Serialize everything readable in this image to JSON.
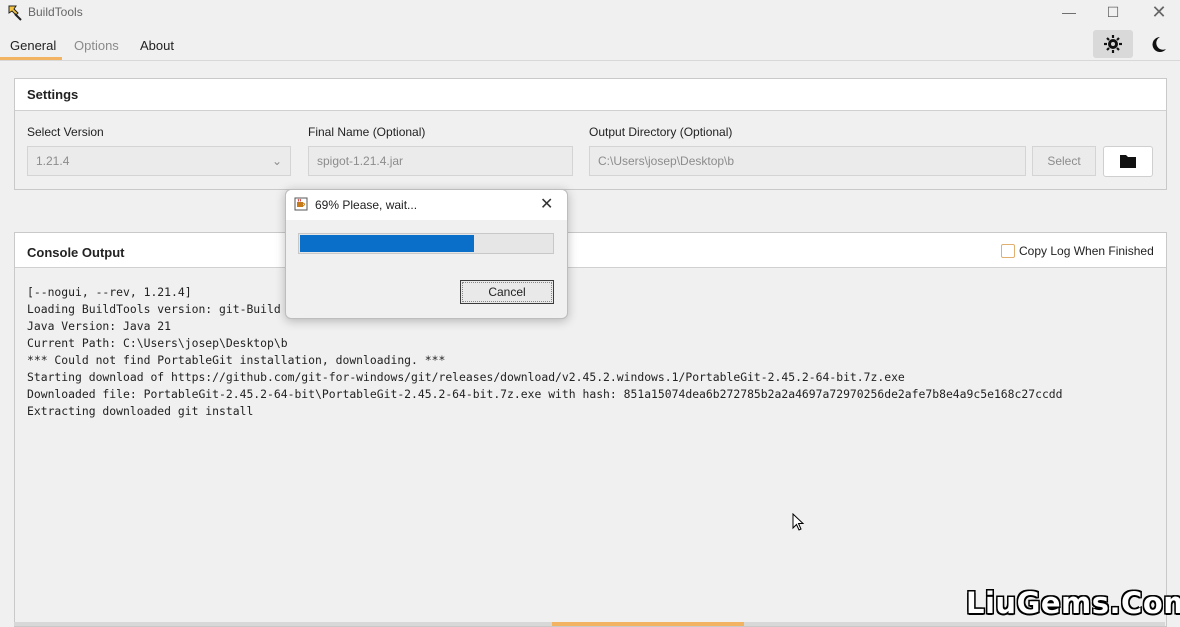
{
  "window": {
    "title": "BuildTools"
  },
  "tabs": [
    {
      "label": "General",
      "active": true
    },
    {
      "label": "Options",
      "disabled": true
    },
    {
      "label": "About"
    }
  ],
  "settings": {
    "title": "Settings",
    "version": {
      "label": "Select Version",
      "value": "1.21.4"
    },
    "final_name": {
      "label": "Final Name (Optional)",
      "value": "spigot-1.21.4.jar"
    },
    "output_dir": {
      "label": "Output Directory (Optional)",
      "value": "C:\\Users\\josep\\Desktop\\b"
    },
    "select_label": "Select"
  },
  "console": {
    "title": "Console Output",
    "copy_log_label": "Copy Log When Finished",
    "copy_log_checked": false,
    "lines": [
      "[--nogui, --rev, 1.21.4]",
      "Loading BuildTools version: git-Build",
      "Java Version: Java 21",
      "Current Path: C:\\Users\\josep\\Desktop\\b",
      "*** Could not find PortableGit installation, downloading. ***",
      "Starting download of https://github.com/git-for-windows/git/releases/download/v2.45.2.windows.1/PortableGit-2.45.2-64-bit.7z.exe",
      "Downloaded file: PortableGit-2.45.2-64-bit\\PortableGit-2.45.2-64-bit.7z.exe with hash: 851a15074dea6b272785b2a2a4697a72970256de2afe7b8e4a9c5e168c27ccdd",
      "Extracting downloaded git install"
    ]
  },
  "dialog": {
    "title": "69% Please, wait...",
    "progress": 0.69,
    "cancel_label": "Cancel"
  },
  "colors": {
    "accent": "#f2b463",
    "progress": "#0a6fc8",
    "background": "#f0f0f0"
  },
  "watermark": "LiuGems.Com"
}
